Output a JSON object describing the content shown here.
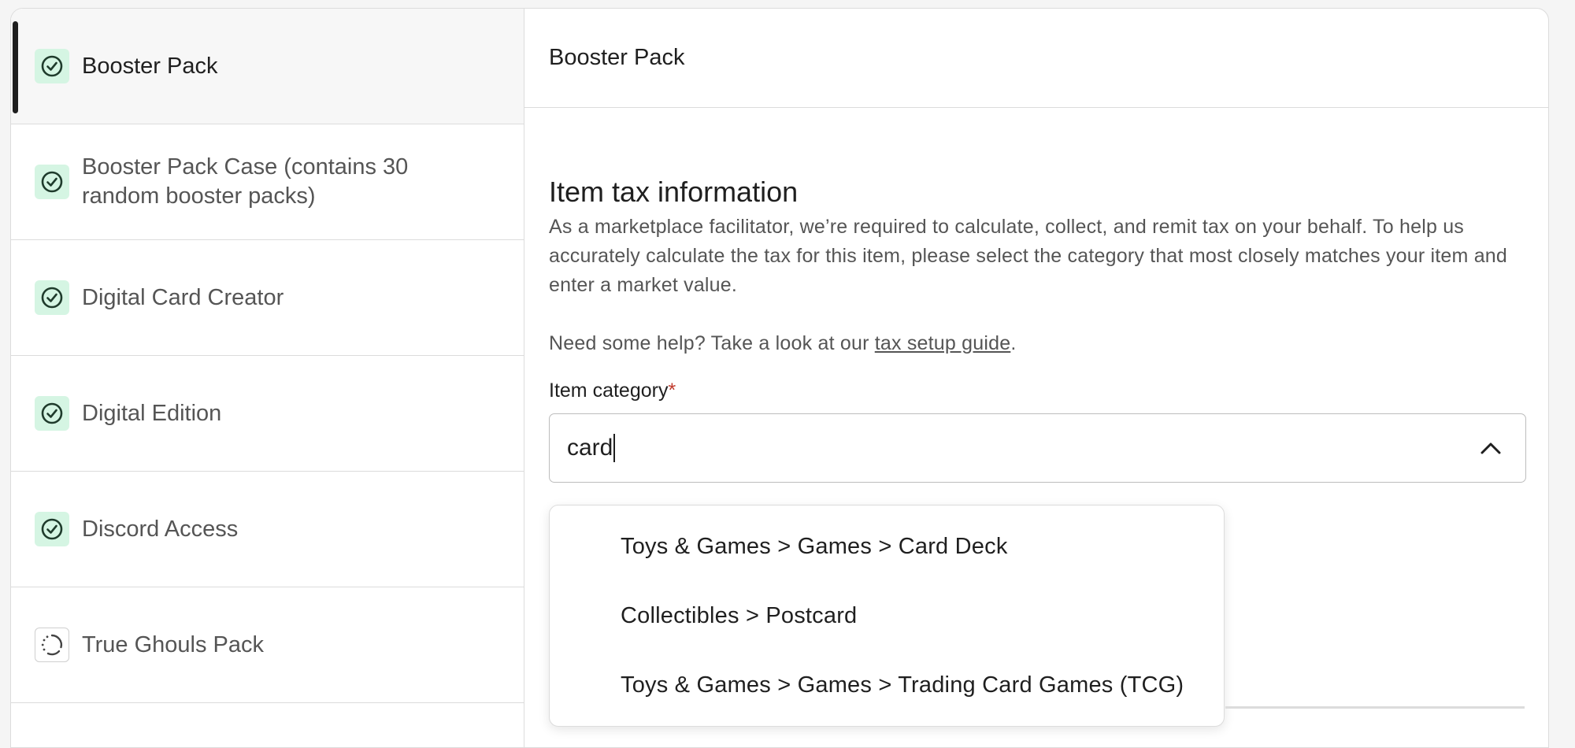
{
  "sidebar": {
    "items": [
      {
        "label": "Booster Pack",
        "status": "check-circle-icon",
        "active": true
      },
      {
        "label": "Booster Pack Case (contains 30 random booster packs)",
        "status": "check-circle-icon"
      },
      {
        "label": "Digital Card Creator",
        "status": "check-circle-icon"
      },
      {
        "label": "Digital Edition",
        "status": "check-circle-icon"
      },
      {
        "label": "Discord Access",
        "status": "check-circle-icon"
      },
      {
        "label": "True Ghouls Pack",
        "status": "loading-spinner-icon"
      }
    ]
  },
  "main": {
    "header_title": "Booster Pack",
    "section_title": "Item tax information",
    "section_desc": "As a marketplace facilitator, we’re required to calculate, collect, and remit tax on your behalf. To help us accurately calculate the tax for this item, please select the category that most closely matches your item and enter a market value.",
    "help_prefix": "Need some help? Take a look at our ",
    "help_link": "tax setup guide",
    "help_suffix": ".",
    "category_label": "Item category",
    "required_mark": "*",
    "category_value": "card",
    "dropdown_options": [
      "Toys & Games > Games > Card Deck",
      "Collectibles > Postcard",
      "Toys & Games > Games > Trading Card Games (TCG)"
    ]
  },
  "colors": {
    "check_bg": "#d5f5e3",
    "check_stroke": "#1f3b2c",
    "required": "#c0392b"
  }
}
